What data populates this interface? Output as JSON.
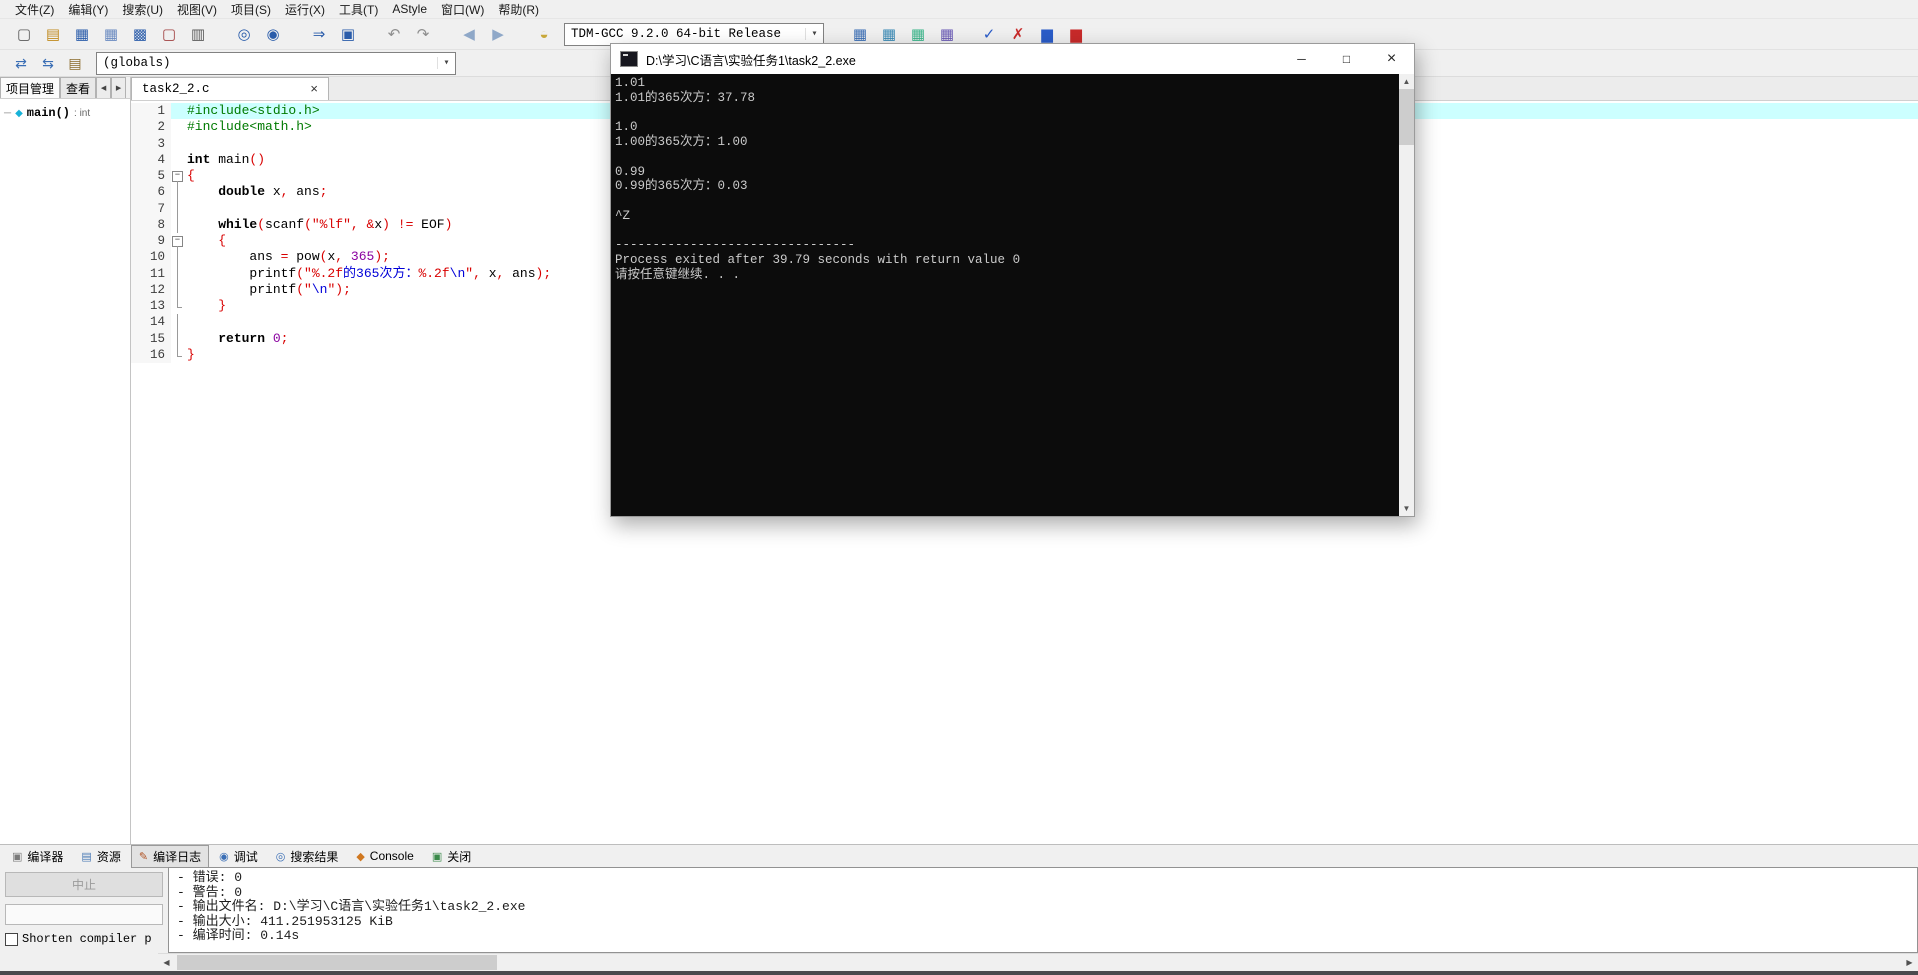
{
  "glyphs": {
    "dropdown": "▾",
    "tab_close": "×",
    "scroll_up": "▲",
    "scroll_down": "▼",
    "scroll_left": "◀",
    "scroll_right": "▶",
    "minimize": "─",
    "maximize": "□",
    "close": "×",
    "expander_minus": "−",
    "tree_dash": "─",
    "tree_gem": "◆"
  },
  "menu": {
    "items": [
      "文件(Z)",
      "编辑(Y)",
      "搜索(U)",
      "视图(V)",
      "项目(S)",
      "运行(X)",
      "工具(T)",
      "AStyle",
      "窗口(W)",
      "帮助(R)"
    ]
  },
  "toolbar_main": {
    "compiler_selected": "TDM-GCC 9.2.0 64-bit Release",
    "icon_groups": [
      [
        {
          "name": "new-file",
          "glyph": "▢",
          "color": "#5a5a5a"
        },
        {
          "name": "open-file",
          "glyph": "▤",
          "color": "#c08a1e"
        },
        {
          "name": "save",
          "glyph": "▦",
          "color": "#2a5caa"
        },
        {
          "name": "save-as",
          "glyph": "▦",
          "color": "#6a8ac0"
        },
        {
          "name": "save-all",
          "glyph": "▩",
          "color": "#2a5caa"
        },
        {
          "name": "close-file",
          "glyph": "▢",
          "color": "#a04040"
        },
        {
          "name": "print",
          "glyph": "▥",
          "color": "#5a5a5a"
        }
      ],
      [
        {
          "name": "find",
          "glyph": "◎",
          "color": "#2a5caa"
        },
        {
          "name": "replace",
          "glyph": "◉",
          "color": "#2a5caa"
        }
      ],
      [
        {
          "name": "goto-line",
          "glyph": "⇒",
          "color": "#2a5caa"
        },
        {
          "name": "bookmark",
          "glyph": "▣",
          "color": "#2a5caa"
        }
      ],
      [
        {
          "name": "undo",
          "glyph": "↶",
          "color": "#8f8f8f"
        },
        {
          "name": "redo",
          "glyph": "↷",
          "color": "#8f8f8f"
        }
      ],
      [
        {
          "name": "back",
          "glyph": "◀",
          "color": "#8fa8c8"
        },
        {
          "name": "forward",
          "glyph": "▶",
          "color": "#8fa8c8"
        }
      ],
      [
        {
          "name": "comment-balloon",
          "glyph": "◒",
          "color": "#c8a83a"
        }
      ]
    ],
    "build_icons": [
      {
        "name": "compile",
        "glyph": "▦",
        "color": "#3a6eb5"
      },
      {
        "name": "run",
        "glyph": "▦",
        "color": "#3a8ab5"
      },
      {
        "name": "compile-run",
        "glyph": "▦",
        "color": "#3ab58a"
      },
      {
        "name": "rebuild",
        "glyph": "▦",
        "color": "#6a5ab5"
      }
    ],
    "check_icons": [
      {
        "name": "syntax-check",
        "glyph": "✓",
        "color": "#2a5cc8"
      },
      {
        "name": "abort-compile",
        "glyph": "✗",
        "color": "#c82a2a"
      },
      {
        "name": "profile",
        "glyph": "▆",
        "color": "#2a5cc8"
      },
      {
        "name": "profile-delete",
        "glyph": "▆",
        "color": "#c82a2a"
      }
    ]
  },
  "toolbar_nav": {
    "globals_selected": "(globals)",
    "icons": [
      {
        "name": "swap-header-source",
        "glyph": "⇄",
        "color": "#3a6eb5"
      },
      {
        "name": "goto-declaration",
        "glyph": "⇆",
        "color": "#3a6eb5"
      },
      {
        "name": "class-browser",
        "glyph": "▤",
        "color": "#8a6a2a"
      }
    ]
  },
  "sidebar": {
    "tabs": [
      {
        "name": "sidebar-tab-project",
        "label": "项目管理",
        "active": true
      },
      {
        "name": "sidebar-tab-view",
        "label": "查看",
        "active": false
      }
    ],
    "tree": [
      {
        "name": "tree-item-main",
        "label": "main()",
        "type": ": int"
      }
    ]
  },
  "editor": {
    "tab_label": "task2_2.c",
    "lines": [
      {
        "n": 1,
        "fold": "none",
        "hl": true,
        "segs": [
          [
            "#include<stdio.h>",
            "pp"
          ]
        ]
      },
      {
        "n": 2,
        "fold": "none",
        "segs": [
          [
            "#include<math.h>",
            "pp"
          ]
        ]
      },
      {
        "n": 3,
        "fold": "none",
        "segs": []
      },
      {
        "n": 4,
        "fold": "none",
        "segs": [
          [
            "int",
            "kw"
          ],
          [
            " main",
            "pl"
          ],
          [
            "()",
            "sym"
          ]
        ]
      },
      {
        "n": 5,
        "fold": "box",
        "segs": [
          [
            "{",
            "sym"
          ]
        ]
      },
      {
        "n": 6,
        "fold": "v",
        "segs": [
          [
            "    ",
            "pl"
          ],
          [
            "double",
            "kw"
          ],
          [
            " x",
            "pl"
          ],
          [
            ",",
            "sym"
          ],
          [
            " ans",
            "pl"
          ],
          [
            ";",
            "sym"
          ]
        ]
      },
      {
        "n": 7,
        "fold": "v",
        "segs": []
      },
      {
        "n": 8,
        "fold": "v",
        "segs": [
          [
            "    ",
            "pl"
          ],
          [
            "while",
            "kw"
          ],
          [
            "(",
            "sym"
          ],
          [
            "scanf",
            "pl"
          ],
          [
            "(",
            "sym"
          ],
          [
            "\"%lf\"",
            "str"
          ],
          [
            ",",
            "sym"
          ],
          [
            " ",
            "pl"
          ],
          [
            "&",
            "sym"
          ],
          [
            "x",
            "pl"
          ],
          [
            ")",
            "sym"
          ],
          [
            " ",
            "pl"
          ],
          [
            "!=",
            "sym"
          ],
          [
            " EOF",
            "pl"
          ],
          [
            ")",
            "sym"
          ]
        ]
      },
      {
        "n": 9,
        "fold": "box",
        "segs": [
          [
            "    ",
            "pl"
          ],
          [
            "{",
            "sym"
          ]
        ]
      },
      {
        "n": 10,
        "fold": "v",
        "segs": [
          [
            "        ans ",
            "pl"
          ],
          [
            "=",
            "sym"
          ],
          [
            " pow",
            "pl"
          ],
          [
            "(",
            "sym"
          ],
          [
            "x",
            "pl"
          ],
          [
            ",",
            "sym"
          ],
          [
            " ",
            "pl"
          ],
          [
            "365",
            "num"
          ],
          [
            ");",
            "sym"
          ]
        ]
      },
      {
        "n": 11,
        "fold": "v",
        "segs": [
          [
            "        printf",
            "pl"
          ],
          [
            "(",
            "sym"
          ],
          [
            "\"%.2f",
            "str"
          ],
          [
            "的365次方：",
            "zh"
          ],
          [
            "%.2f",
            "str"
          ],
          [
            "\\n",
            "esc"
          ],
          [
            "\"",
            "str"
          ],
          [
            ",",
            "sym"
          ],
          [
            " x",
            "pl"
          ],
          [
            ",",
            "sym"
          ],
          [
            " ans",
            "pl"
          ],
          [
            ");",
            "sym"
          ]
        ]
      },
      {
        "n": 12,
        "fold": "v",
        "segs": [
          [
            "        printf",
            "pl"
          ],
          [
            "(",
            "sym"
          ],
          [
            "\"",
            "str"
          ],
          [
            "\\n",
            "esc"
          ],
          [
            "\"",
            "str"
          ],
          [
            ");",
            "sym"
          ]
        ]
      },
      {
        "n": 13,
        "fold": "end",
        "segs": [
          [
            "    ",
            "pl"
          ],
          [
            "}",
            "sym"
          ]
        ]
      },
      {
        "n": 14,
        "fold": "v",
        "segs": []
      },
      {
        "n": 15,
        "fold": "v",
        "segs": [
          [
            "    ",
            "pl"
          ],
          [
            "return",
            "kw"
          ],
          [
            " ",
            "pl"
          ],
          [
            "0",
            "num"
          ],
          [
            ";",
            "sym"
          ]
        ]
      },
      {
        "n": 16,
        "fold": "end",
        "segs": [
          [
            "}",
            "sym"
          ]
        ]
      }
    ]
  },
  "console_window": {
    "title": "D:\\学习\\C语言\\实验任务1\\task2_2.exe",
    "lines": [
      "1.01",
      "1.01的365次方：37.78",
      "",
      "1.0",
      "1.00的365次方：1.00",
      "",
      "0.99",
      "0.99的365次方：0.03",
      "",
      "^Z",
      "",
      "--------------------------------",
      "Process exited after 39.79 seconds with return value 0",
      "请按任意键继续. . ."
    ]
  },
  "bottom_panel": {
    "tabs": [
      {
        "name": "tab-compiler",
        "label": "编译器",
        "glyph": "▣",
        "color": "#7a7a7a",
        "active": false
      },
      {
        "name": "tab-resources",
        "label": "资源",
        "glyph": "▤",
        "color": "#4a7ab5",
        "active": false
      },
      {
        "name": "tab-compile-log",
        "label": "编译日志",
        "glyph": "✎",
        "color": "#b05020",
        "active": true
      },
      {
        "name": "tab-debug",
        "label": "调试",
        "glyph": "◉",
        "color": "#3a6eb5",
        "active": false
      },
      {
        "name": "tab-search-results",
        "label": "搜索结果",
        "glyph": "◎",
        "color": "#3a6eb5",
        "active": false
      },
      {
        "name": "tab-console",
        "label": "Console",
        "glyph": "◆",
        "color": "#d07820",
        "active": false
      },
      {
        "name": "tab-close",
        "label": "关闭",
        "glyph": "▣",
        "color": "#3a8a4a",
        "active": false
      }
    ],
    "abort_label": "中止",
    "checkbox_label": "Shorten compiler p",
    "log_lines": [
      "- 错误: 0",
      "- 警告: 0",
      "- 输出文件名: D:\\学习\\C语言\\实验任务1\\task2_2.exe",
      "- 输出大小: 411.251953125 KiB",
      "- 编译时间: 0.14s"
    ]
  }
}
